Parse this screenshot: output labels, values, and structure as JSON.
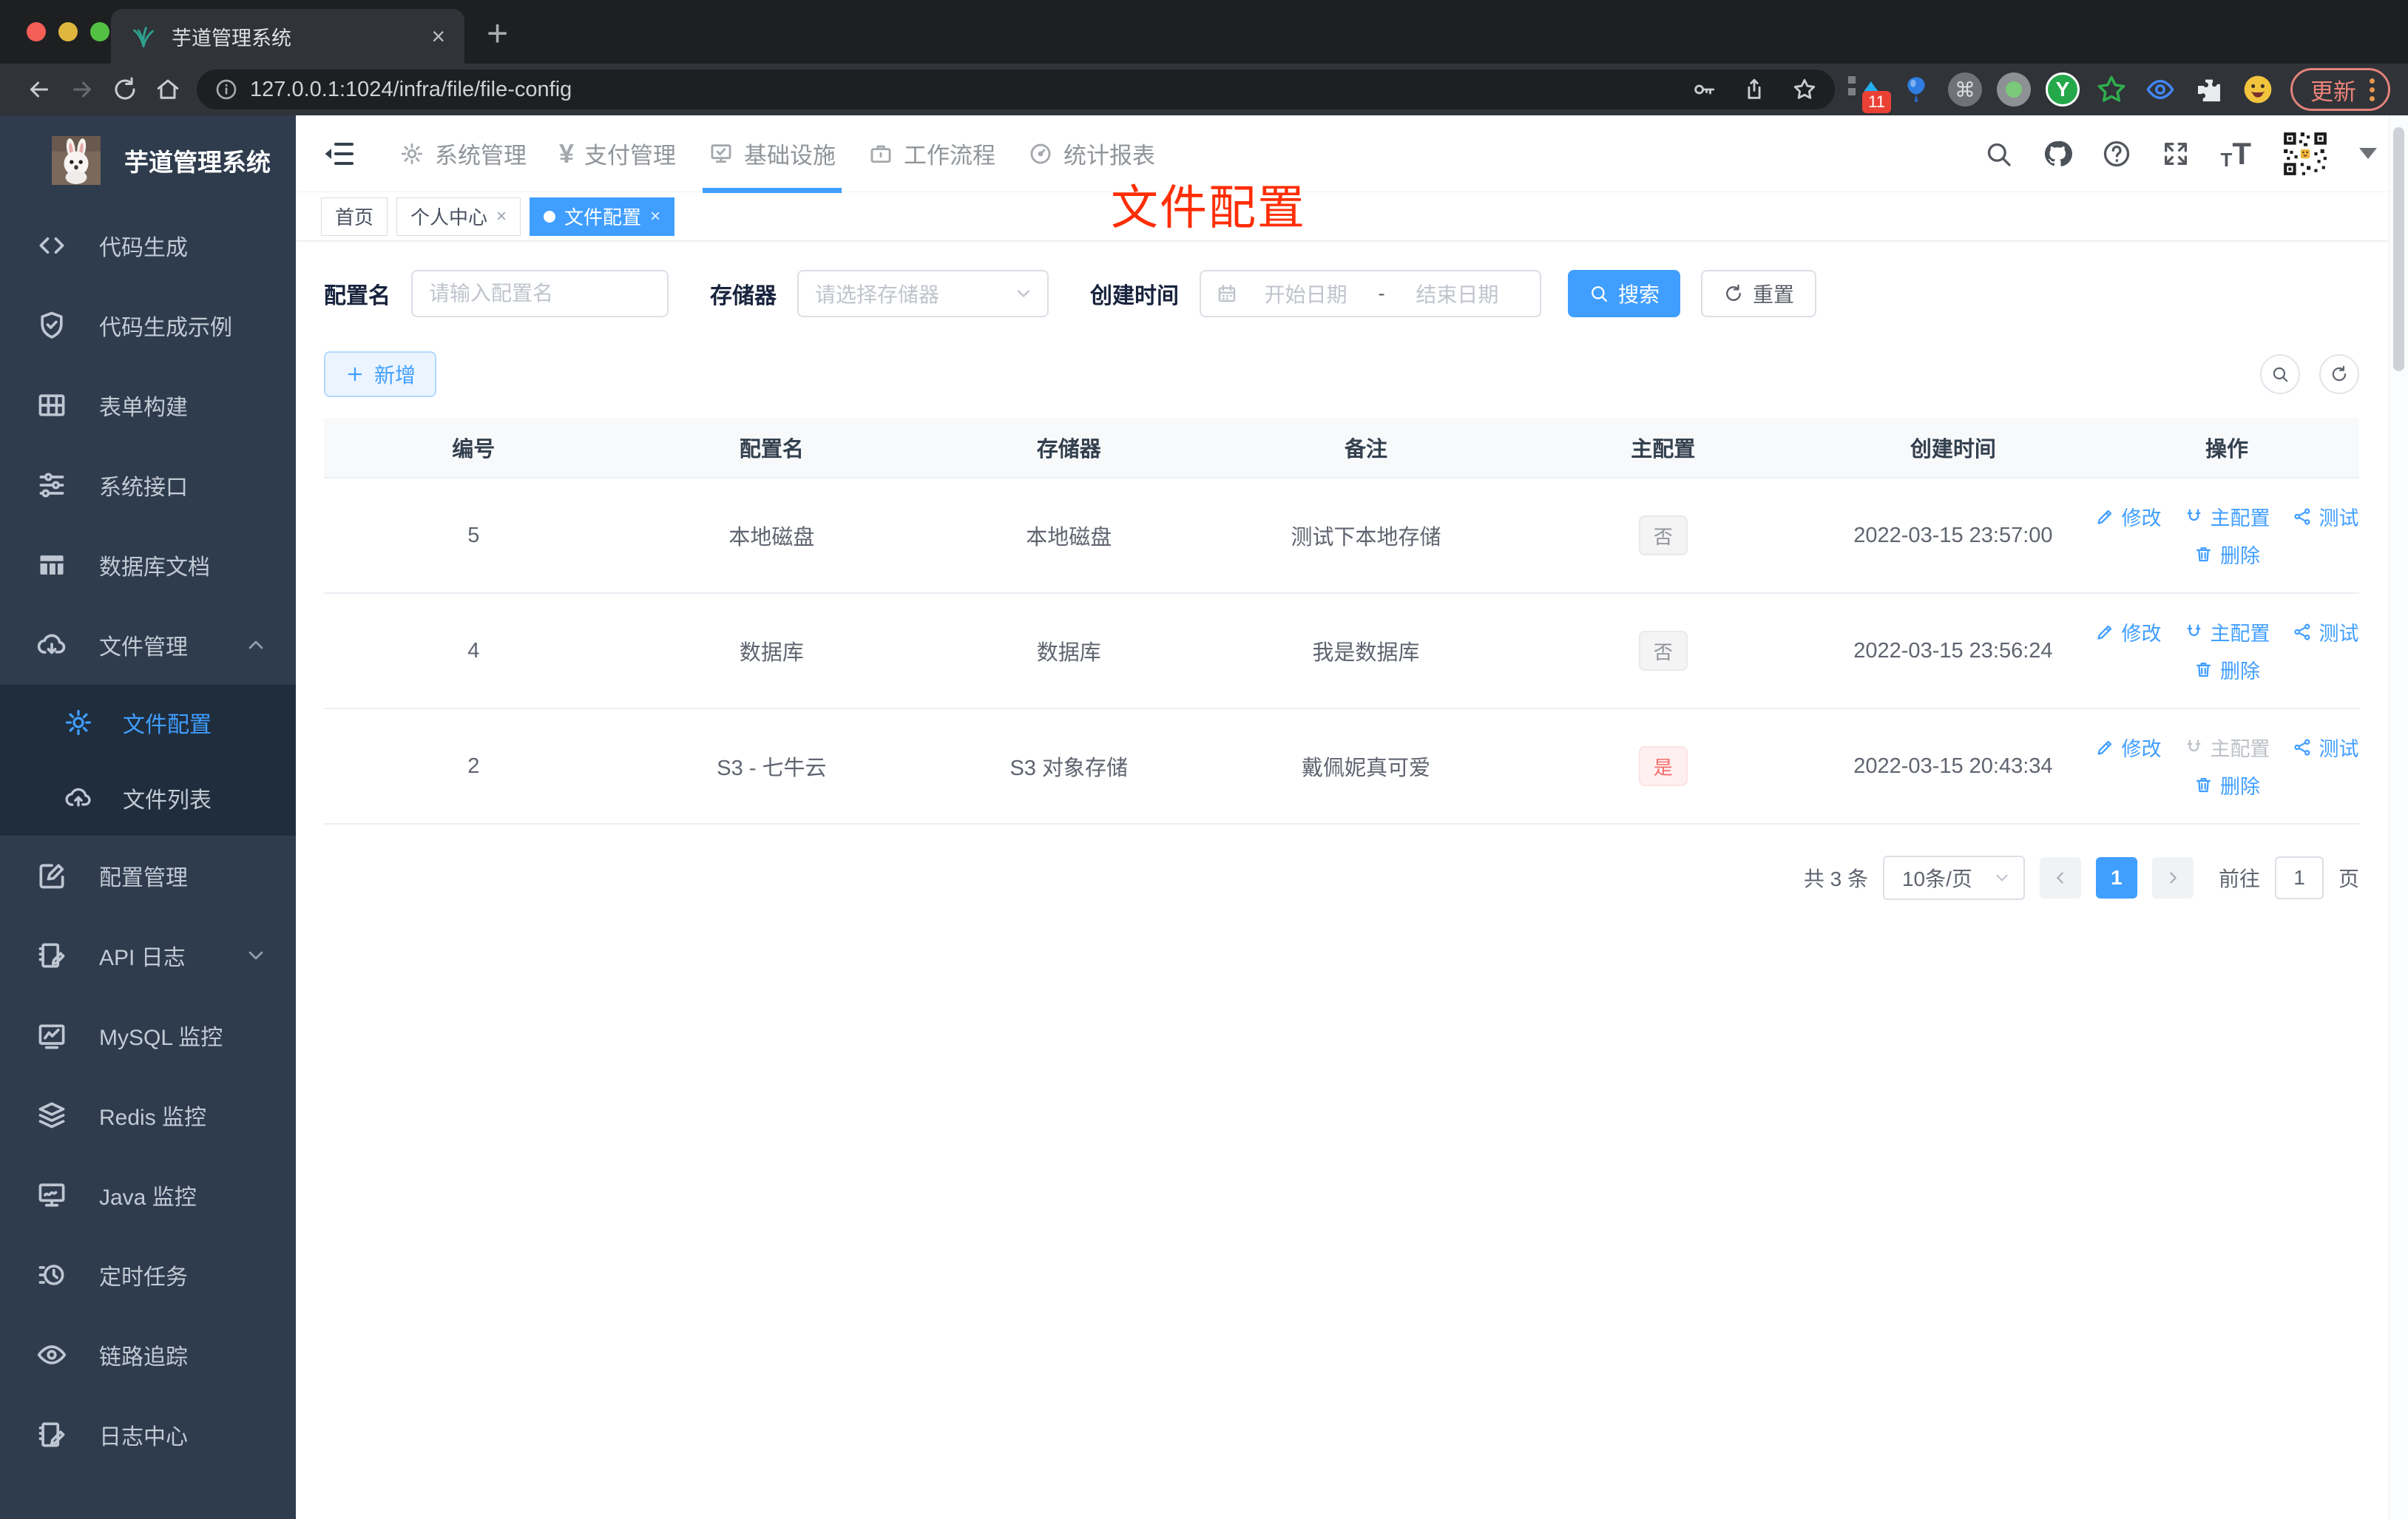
{
  "browser": {
    "tab_title": "芋道管理系统",
    "url": "127.0.0.1:1024/infra/file/file-config",
    "update_label": "更新",
    "extension_badge": "11",
    "glyphs": {
      "close": "×",
      "new_tab": "+",
      "diamond": "♦",
      "command": "⌘",
      "y_letter": "Y"
    }
  },
  "sidebar": {
    "title": "芋道管理系统",
    "items": [
      {
        "label": "代码生成"
      },
      {
        "label": "代码生成示例"
      },
      {
        "label": "表单构建"
      },
      {
        "label": "系统接口"
      },
      {
        "label": "数据库文档"
      },
      {
        "label": "文件管理",
        "children": [
          {
            "label": "文件配置"
          },
          {
            "label": "文件列表"
          }
        ]
      },
      {
        "label": "配置管理"
      },
      {
        "label": "API 日志"
      },
      {
        "label": "MySQL 监控"
      },
      {
        "label": "Redis 监控"
      },
      {
        "label": "Java 监控"
      },
      {
        "label": "定时任务"
      },
      {
        "label": "链路追踪"
      },
      {
        "label": "日志中心"
      }
    ]
  },
  "topnav": {
    "items": [
      {
        "label": "系统管理"
      },
      {
        "label": "支付管理"
      },
      {
        "label": "基础设施"
      },
      {
        "label": "工作流程"
      },
      {
        "label": "统计报表"
      }
    ],
    "active": "基础设施",
    "yen": "¥"
  },
  "tabs": [
    {
      "label": "首页"
    },
    {
      "label": "个人中心"
    },
    {
      "label": "文件配置"
    }
  ],
  "annotation": {
    "text": "文件配置",
    "color": "#ff2d05"
  },
  "filters": {
    "name_label": "配置名",
    "name_placeholder": "请输入配置名",
    "storage_label": "存储器",
    "storage_placeholder": "请选择存储器",
    "date_label": "创建时间",
    "date_start": "开始日期",
    "date_separator": "-",
    "date_end": "结束日期",
    "search_label": "搜索",
    "reset_label": "重置"
  },
  "toolbar": {
    "add_label": "新增"
  },
  "table": {
    "columns": [
      "编号",
      "配置名",
      "存储器",
      "备注",
      "主配置",
      "创建时间",
      "操作"
    ],
    "actions": {
      "edit": "修改",
      "master": "主配置",
      "test": "测试",
      "remove": "删除"
    },
    "rows": [
      {
        "id": "5",
        "name": "本地磁盘",
        "storage": "本地磁盘",
        "remark": "测试下本地存储",
        "primary": "否",
        "created": "2022-03-15 23:57:00"
      },
      {
        "id": "4",
        "name": "数据库",
        "storage": "数据库",
        "remark": "我是数据库",
        "primary": "否",
        "created": "2022-03-15 23:56:24"
      },
      {
        "id": "2",
        "name": "S3 - 七牛云",
        "storage": "S3 对象存储",
        "remark": "戴佩妮真可爱",
        "primary": "是",
        "created": "2022-03-15 20:43:34"
      }
    ]
  },
  "pagination": {
    "total": "共 3 条",
    "page_size": "10条/页",
    "page": "1",
    "goto_label": "前往",
    "page_unit": "页",
    "goto_value": "1"
  },
  "colors": {
    "accent": "#409eff",
    "danger": "#f56c6c",
    "sidebar_bg": "#2e3c4e",
    "annotation": "#ff2d05"
  }
}
